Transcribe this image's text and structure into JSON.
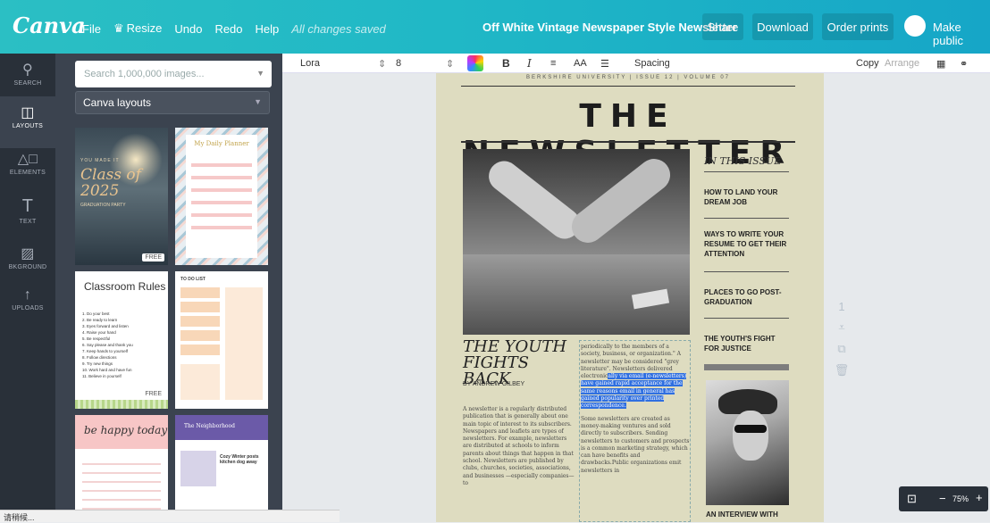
{
  "topbar": {
    "logo": "Canva",
    "nav": [
      "File",
      "Resize",
      "Undo",
      "Redo",
      "Help"
    ],
    "saved_status": "All changes saved",
    "doc_title": "Off White Vintage Newspaper Style Newsletter",
    "share": "Share",
    "download": "Download",
    "order_prints": "Order prints",
    "make_public": "Make public"
  },
  "sidebar": {
    "items": [
      {
        "label": "SEARCH",
        "icon": "search-icon"
      },
      {
        "label": "LAYOUTS",
        "icon": "layouts-icon"
      },
      {
        "label": "ELEMENTS",
        "icon": "shapes-icon"
      },
      {
        "label": "TEXT",
        "icon": "text-icon"
      },
      {
        "label": "BKGROUND",
        "icon": "background-icon"
      },
      {
        "label": "UPLOADS",
        "icon": "upload-icon"
      }
    ]
  },
  "panel": {
    "search_placeholder": "Search 1,000,000 images...",
    "layouts_select": "Canva layouts",
    "templates": [
      {
        "title": "Class of 2025",
        "kicker": "YOU MADE IT",
        "sub": "GRADUATION PARTY",
        "badge": "FREE"
      },
      {
        "title": "My Daily Planner"
      },
      {
        "title": "Classroom Rules",
        "badge": "FREE",
        "rules": [
          "1. Do your best",
          "2. Be ready to learn",
          "3. Eyes forward and listen",
          "4. Raise your hand",
          "5. Be respectful",
          "6. Say please and thank you",
          "7. Keep hands to yourself",
          "8. Follow directions",
          "9. Try new things",
          "10. Work hard and have fun",
          "11. Believe in yourself"
        ]
      },
      {
        "title": "TO DO LIST"
      },
      {
        "title": "be happy today"
      },
      {
        "title": "The Neighborhood",
        "sub": "Cozy Winter posts kitchen dog away"
      }
    ]
  },
  "toolbar": {
    "font": "Lora",
    "font_size": "8",
    "bold": "B",
    "italic": "I",
    "case": "AA",
    "spacing": "Spacing",
    "copy": "Copy",
    "arrange": "Arrange"
  },
  "page": {
    "topline": "BERKSHIRE UNIVERSITY | ISSUE 12 | VOLUME 07",
    "masthead": "THE NEWSLETTER",
    "toc_title": "IN THIS ISSUE",
    "toc": [
      "HOW TO LAND YOUR DREAM JOB",
      "WAYS TO WRITE YOUR RESUME TO GET THEIR ATTENTION",
      "PLACES TO GO POST-GRADUATION",
      "THE YOUTH'S FIGHT FOR JUSTICE"
    ],
    "headline": "THE YOUTH FIGHTS BACK",
    "byline": "BY ANDREW GILBEY",
    "body_left": "A newsletter is a regularly distributed publication that is generally about one main topic of interest to its subscribers. Newspapers and leaflets are types of newsletters. For example, newsletters are distributed at schools to inform parents about things that happen in that school. Newsletters are published by clubs, churches, societies, associations, and businesses —especially companies—to",
    "body_right_a": "periodically to the members of a society, business, or organization.\" A newsletter may be considered \"grey literature\". Newsletters delivered electronic",
    "body_right_sel": "ally via email (e-newsletters) have gained rapid acceptance for the same reasons email in general has gained popularity over printed correspondence.",
    "body_right_b": "Some newsletters are created as money-making ventures and sold directly to subscribers. Sending newsletters to customers and prospects is a common marketing strategy, which can have benefits and drawbacks.Public organizations emit newsletters in",
    "portrait_caption": "AN INTERVIEW WITH"
  },
  "canvas_tools": {
    "page_number": "1"
  },
  "zoom": {
    "level": "75%"
  },
  "statusbar": "请稍候..."
}
